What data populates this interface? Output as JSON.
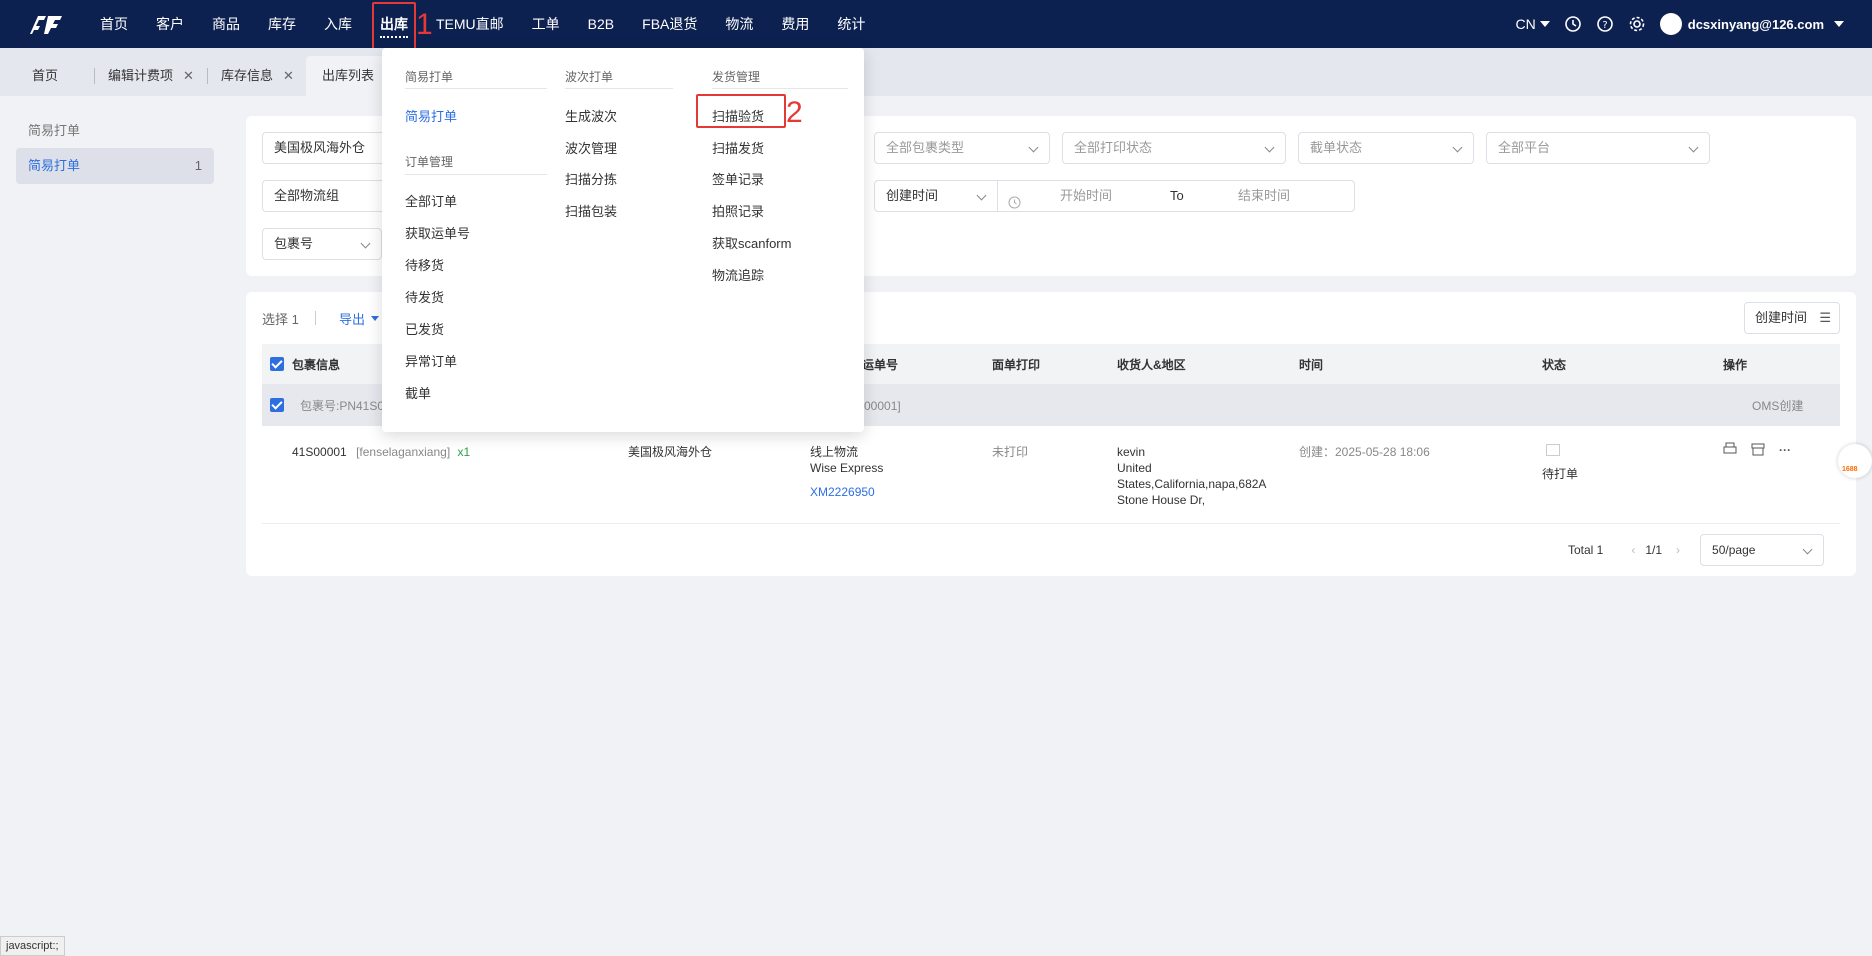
{
  "nav": {
    "items": [
      "首页",
      "客户",
      "商品",
      "库存",
      "入库",
      "出库",
      "TEMU直邮",
      "工单",
      "B2B",
      "FBA退货",
      "物流",
      "费用",
      "统计"
    ],
    "active": "出库",
    "lang": "CN",
    "user": "dcsxinyang@126.com"
  },
  "annotations": {
    "one": "1",
    "two": "2"
  },
  "tabs": [
    "首页",
    "编辑计费项",
    "库存信息",
    "出库列表"
  ],
  "sidebar": {
    "title": "简易打单",
    "item": {
      "label": "简易打单",
      "count": "1"
    }
  },
  "filters": {
    "warehouse": "美国极风海外仓",
    "logistics_group": "全部物流组",
    "package_no": "包裹号",
    "package_type": "全部包裹类型",
    "print_status": "全部打印状态",
    "intercept_status": "截单状态",
    "platform": "全部平台",
    "time_type": "创建时间",
    "start_time": "开始时间",
    "to": "To",
    "end_time": "结束时间"
  },
  "toolbar": {
    "selected": "选择 1",
    "export": "导出",
    "sort": "创建时间"
  },
  "table": {
    "headers": [
      "包裹信息",
      "运单号",
      "面单打印",
      "收货人&地区",
      "时间",
      "状态",
      "操作"
    ],
    "group": {
      "package": "包裹号:PN41S0",
      "ref": "00001]",
      "source": "OMS创建"
    },
    "row": {
      "sku": "41S00001",
      "name": "[fenselaganxiang]",
      "qty": "x1",
      "warehouse": "美国极风海外仓",
      "carrier": "线上物流",
      "service": "Wise Express",
      "tracking": "XM2226950",
      "print": "未打印",
      "recipient": "kevin",
      "addr1": "United",
      "addr2": "States,California,napa,682A",
      "addr3": "Stone House Dr,",
      "time": "创建：2025-05-28 18:06",
      "status": "待打单"
    }
  },
  "pagination": {
    "total": "Total 1",
    "page": "1/1",
    "size": "50/page"
  },
  "dropdown": {
    "col1": {
      "head": "简易打单",
      "items": [
        "简易打单"
      ]
    },
    "col1b": {
      "head": "订单管理",
      "items": [
        "全部订单",
        "获取运单号",
        "待移货",
        "待发货",
        "已发货",
        "异常订单",
        "截单"
      ]
    },
    "col2": {
      "head": "波次打单",
      "items": [
        "生成波次",
        "波次管理",
        "扫描分拣",
        "扫描包装"
      ]
    },
    "col3": {
      "head": "发货管理",
      "items": [
        "扫描验货",
        "扫描发货",
        "签单记录",
        "拍照记录",
        "获取scanform",
        "物流追踪"
      ]
    }
  },
  "float_badge": "1688",
  "statusbar": "javascript:;"
}
